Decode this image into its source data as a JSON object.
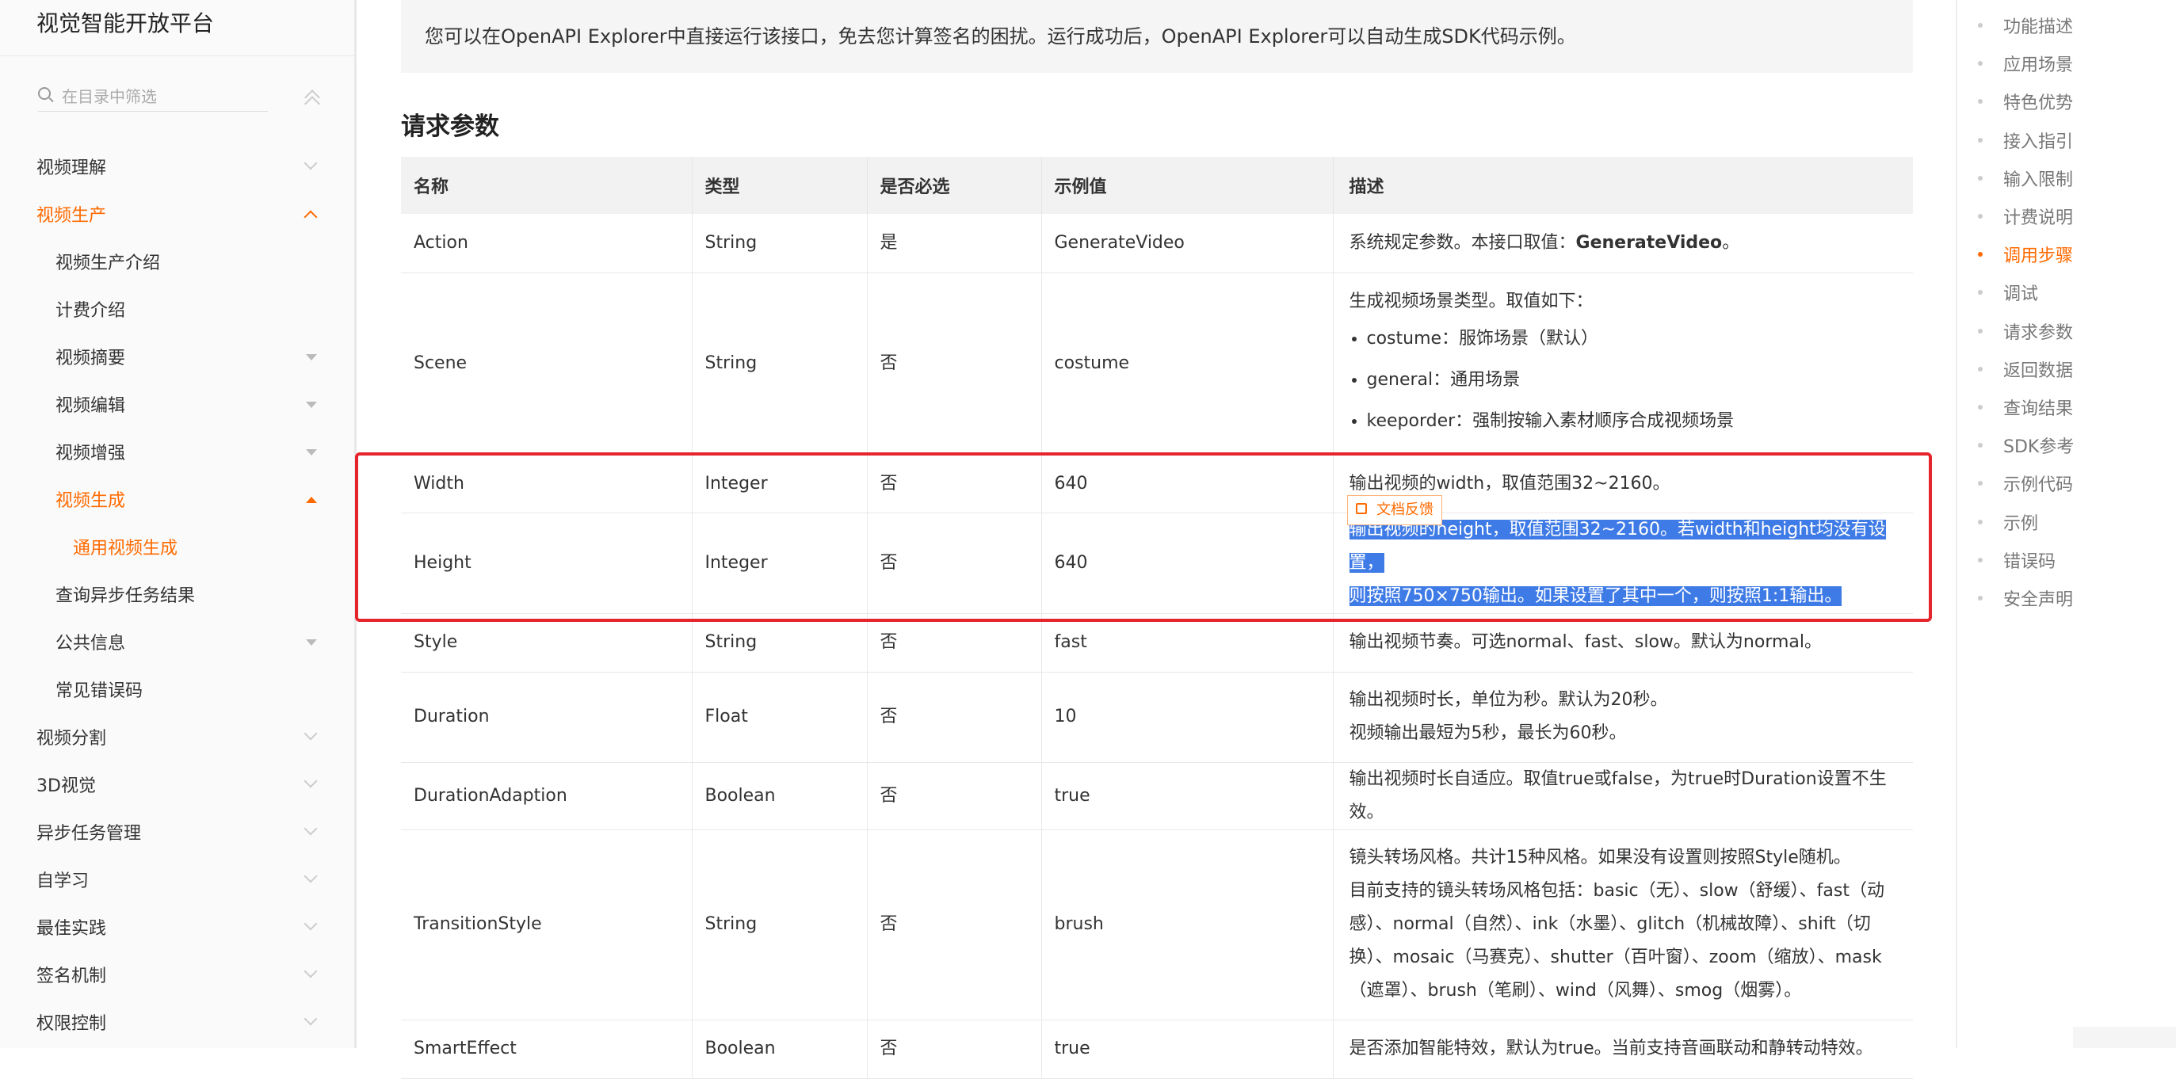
{
  "sidebar": {
    "brand": "视觉智能开放平台",
    "filter_placeholder": "在目录中筛选",
    "items": [
      {
        "label": "视频理解",
        "level": 1,
        "state": "collapsed"
      },
      {
        "label": "视频生产",
        "level": 1,
        "state": "expanded-active"
      },
      {
        "label": "视频生产介绍",
        "level": 2
      },
      {
        "label": "计费介绍",
        "level": 2
      },
      {
        "label": "视频摘要",
        "level": 2,
        "state": "collapsed"
      },
      {
        "label": "视频编辑",
        "level": 2,
        "state": "collapsed"
      },
      {
        "label": "视频增强",
        "level": 2,
        "state": "collapsed"
      },
      {
        "label": "视频生成",
        "level": 2,
        "state": "expanded-active"
      },
      {
        "label": "通用视频生成",
        "level": 3,
        "state": "current"
      },
      {
        "label": "查询异步任务结果",
        "level": 2
      },
      {
        "label": "公共信息",
        "level": 2,
        "state": "collapsed"
      },
      {
        "label": "常见错误码",
        "level": 2
      },
      {
        "label": "视频分割",
        "level": 1,
        "state": "collapsed"
      },
      {
        "label": "3D视觉",
        "level": 1,
        "state": "collapsed"
      },
      {
        "label": "异步任务管理",
        "level": 1,
        "state": "collapsed"
      },
      {
        "label": "自学习",
        "level": 1,
        "state": "collapsed"
      },
      {
        "label": "最佳实践",
        "level": 1,
        "state": "collapsed"
      },
      {
        "label": "签名机制",
        "level": 1,
        "state": "collapsed"
      },
      {
        "label": "权限控制",
        "level": 1,
        "state": "collapsed"
      }
    ]
  },
  "main": {
    "notice": "您可以在OpenAPI Explorer中直接运行该接口，免去您计算签名的困扰。运行成功后，OpenAPI Explorer可以自动生成SDK代码示例。",
    "section_title": "请求参数",
    "feedback_label": "文档反馈",
    "columns": [
      "名称",
      "类型",
      "是否必选",
      "示例值",
      "描述"
    ],
    "rows": [
      {
        "name": "Action",
        "type": "String",
        "required": "是",
        "example": "GenerateVideo",
        "desc_prefix": "系统规定参数。本接口取值：",
        "desc_bold": "GenerateVideo",
        "desc_suffix": "。"
      },
      {
        "name": "Scene",
        "type": "String",
        "required": "否",
        "example": "costume",
        "desc_intro": "生成视频场景类型。取值如下：",
        "desc_list": [
          "costume：服饰场景（默认）",
          "general：通用场景",
          "keeporder：强制按输入素材顺序合成视频场景"
        ]
      },
      {
        "name": "Width",
        "type": "Integer",
        "required": "否",
        "example": "640",
        "desc": [
          "输出视频的width，取值范围32~2160。"
        ]
      },
      {
        "name": "Height",
        "type": "Integer",
        "required": "否",
        "example": "640",
        "desc": [
          "输出视频的height，取值范围32~2160。若width和height均没有设置，",
          "则按照750×750输出。如果设置了其中一个，则按照1:1输出。"
        ]
      },
      {
        "name": "Style",
        "type": "String",
        "required": "否",
        "example": "fast",
        "desc": [
          "输出视频节奏。可选normal、fast、slow。默认为normal。"
        ]
      },
      {
        "name": "Duration",
        "type": "Float",
        "required": "否",
        "example": "10",
        "desc": [
          "输出视频时长，单位为秒。默认为20秒。",
          "视频输出最短为5秒，最长为60秒。"
        ]
      },
      {
        "name": "DurationAdaption",
        "type": "Boolean",
        "required": "否",
        "example": "true",
        "desc": [
          "输出视频时长自适应。取值true或false，为true时Duration设置不生效。"
        ]
      },
      {
        "name": "TransitionStyle",
        "type": "String",
        "required": "否",
        "example": "brush",
        "desc": [
          "镜头转场风格。共计15种风格。如果没有设置则按照Style随机。",
          "目前支持的镜头转场风格包括：basic（无）、slow（舒缓）、fast（动",
          "感）、normal（自然）、ink（水墨）、glitch（机械故障）、shift（切",
          "换）、mosaic（马赛克）、shutter（百叶窗）、zoom（缩放）、mask",
          "（遮罩）、brush（笔刷）、wind（风舞）、smog（烟雾）。"
        ]
      },
      {
        "name": "SmartEffect",
        "type": "Boolean",
        "required": "否",
        "example": "true",
        "desc": [
          "是否添加智能特效，默认为true。当前支持音画联动和静转动特效。"
        ]
      }
    ]
  },
  "toc": {
    "items": [
      "功能描述",
      "应用场景",
      "特色优势",
      "接入指引",
      "输入限制",
      "计费说明",
      "调用步骤",
      "调试",
      "请求参数",
      "返回数据",
      "查询结果",
      "SDK参考",
      "示例代码",
      "示例",
      "错误码",
      "安全声明"
    ],
    "active_index": 6
  },
  "colors": {
    "accent": "#ff6a00",
    "highlight": "#3f7be6",
    "annotation_box": "#e5242b"
  }
}
